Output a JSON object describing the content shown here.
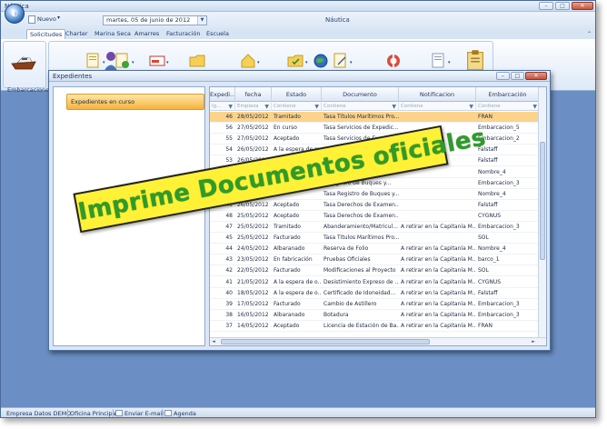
{
  "window": {
    "title": "Náutica",
    "controls": [
      "–",
      "□",
      "✕"
    ]
  },
  "toolbar": {
    "new_label": "Nuevo",
    "date_value": "martes, 05 de junio de 2012",
    "document_title": "Náutica"
  },
  "tabs": [
    {
      "label": "Solicitudes",
      "active": true
    },
    {
      "label": "Charter"
    },
    {
      "label": "Marina Seca"
    },
    {
      "label": "Amarres"
    },
    {
      "label": "Facturación"
    },
    {
      "label": "Escuela"
    }
  ],
  "ribbon": {
    "group_label": "Embarcaciones",
    "icons": [
      "boat-icon",
      "person-icon",
      "document-icon",
      "document-add-icon",
      "card-icon",
      "folder-icon",
      "house-icon",
      "folder-check-icon",
      "globe-icon",
      "document-edit-icon",
      "lifebuoy-icon",
      "report-icon",
      "clipboard-icon"
    ]
  },
  "child_window": {
    "title": "Expedientes",
    "nav_item": "Expedientes en curso"
  },
  "grid": {
    "columns": [
      "Expedi...",
      "fecha",
      "Estado",
      "Documento",
      "Notificacion",
      "Embarcación"
    ],
    "filter_placeholders": [
      "Ig...",
      "Empieza",
      "Contiene",
      "Contiene",
      "Contiene",
      "Contiene"
    ],
    "rows": [
      {
        "id": "46",
        "fecha": "28/05/2012",
        "estado": "Tramitado",
        "documento": "Tasa Títulos Marítimos Pro...",
        "notificacion": "",
        "embarcacion": "FRAN",
        "selected": true
      },
      {
        "id": "56",
        "fecha": "27/05/2012",
        "estado": "En curso",
        "documento": "Tasa Servicios de Expedic...",
        "notificacion": "",
        "embarcacion": "Embarcacion_5"
      },
      {
        "id": "55",
        "fecha": "27/05/2012",
        "estado": "Aceptado",
        "documento": "Tasa Servicios de Expedic...",
        "notificacion": "",
        "embarcacion": "Embarcacion_2"
      },
      {
        "id": "54",
        "fecha": "26/05/2012",
        "estado": "A la espera de m...",
        "documento": "Tasa Servicios de ...",
        "notificacion": "",
        "embarcacion": "Falstaff"
      },
      {
        "id": "53",
        "fecha": "26/05/2012",
        "estado": "Pagado",
        "documento": "",
        "notificacion": "",
        "embarcacion": "Falstaff"
      },
      {
        "id": "52",
        "fecha": "",
        "estado": "",
        "documento": "",
        "notificacion": "",
        "embarcacion": "Nombre_4"
      },
      {
        "id": "51",
        "fecha": "",
        "estado": "",
        "documento": "...Registro de Buques y...",
        "notificacion": "",
        "embarcacion": "Embarcacion_3"
      },
      {
        "id": "50",
        "fecha": "",
        "estado": "",
        "documento": "Tasa Registro de Buques y...",
        "notificacion": "",
        "embarcacion": "Nombre_4"
      },
      {
        "id": "49",
        "fecha": "26/05/2012",
        "estado": "Aceptado",
        "documento": "Tasa Derechos de Examen...",
        "notificacion": "",
        "embarcacion": "Falstaff"
      },
      {
        "id": "48",
        "fecha": "25/05/2012",
        "estado": "Aceptado",
        "documento": "Tasa Derechos de Examen...",
        "notificacion": "",
        "embarcacion": "CYGNUS"
      },
      {
        "id": "47",
        "fecha": "25/05/2012",
        "estado": "Tramitado",
        "documento": "Abanderamiento/Matricul...",
        "notificacion": "A retirar en la Capitanía M...",
        "embarcacion": "Embarcacion_3"
      },
      {
        "id": "45",
        "fecha": "25/05/2012",
        "estado": "Facturado",
        "documento": "Tasa Títulos Marítimos Pro...",
        "notificacion": "",
        "embarcacion": "SOL"
      },
      {
        "id": "44",
        "fecha": "24/05/2012",
        "estado": "Albaranado",
        "documento": "Reserva de Folio",
        "notificacion": "A retirar en la Capitanía M...",
        "embarcacion": "Nombre_4"
      },
      {
        "id": "43",
        "fecha": "23/05/2012",
        "estado": "En fabricación",
        "documento": "Pruebas Oficiales",
        "notificacion": "A retirar en la Capitanía M...",
        "embarcacion": "barco_1"
      },
      {
        "id": "42",
        "fecha": "22/05/2012",
        "estado": "Facturado",
        "documento": "Modificaciones al Proyecto",
        "notificacion": "A retirar en la Capitanía M...",
        "embarcacion": "SOL"
      },
      {
        "id": "41",
        "fecha": "21/05/2012",
        "estado": "A la espera de o...",
        "documento": "Desistimiento Expreso de ...",
        "notificacion": "A retirar en la Capitanía M...",
        "embarcacion": "CYGNUS"
      },
      {
        "id": "40",
        "fecha": "18/05/2012",
        "estado": "A la espera de o...",
        "documento": "Certificado de Idoneidad...",
        "notificacion": "A retirar en la Capitanía M...",
        "embarcacion": "Falstaff"
      },
      {
        "id": "39",
        "fecha": "17/05/2012",
        "estado": "Facturado",
        "documento": "Cambio de Astillero",
        "notificacion": "A retirar en la Capitanía M...",
        "embarcacion": "Embarcacion_3"
      },
      {
        "id": "38",
        "fecha": "16/05/2012",
        "estado": "Albaranado",
        "documento": "Botadura",
        "notificacion": "A retirar en la Capitanía M...",
        "embarcacion": "Embarcacion_3"
      },
      {
        "id": "37",
        "fecha": "14/05/2012",
        "estado": "Aceptado",
        "documento": "Licencia de Estación de Ba...",
        "notificacion": "A retirar en la Capitanía M...",
        "embarcacion": "FRAN"
      }
    ]
  },
  "banner": {
    "text": "Imprime Documentos oficiales",
    "bg": "#fff236",
    "fg": "#2e9b2a"
  },
  "statusbar": {
    "company": "Empresa Datos DEMO",
    "office": "Oficina Principal",
    "email": "Enviar E-mail",
    "agenda": "Agenda"
  },
  "colors": {
    "desktop": "#6b8fc4",
    "selected_row": "#fcd38a",
    "nav_highlight": "#f7b23b"
  }
}
